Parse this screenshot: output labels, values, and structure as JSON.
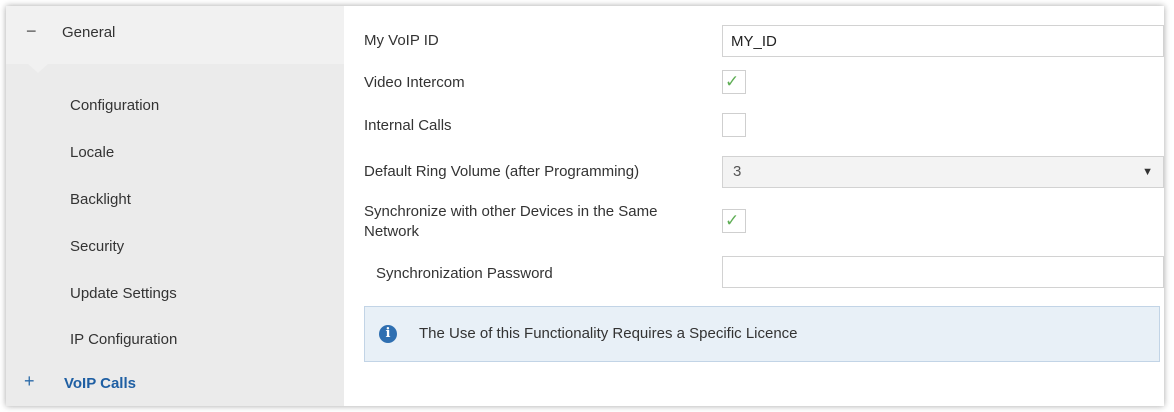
{
  "sidebar": {
    "header": {
      "sign": "−",
      "label": "General"
    },
    "items": [
      {
        "label": "Configuration"
      },
      {
        "label": "Locale"
      },
      {
        "label": "Backlight"
      },
      {
        "label": "Security"
      },
      {
        "label": "Update Settings"
      },
      {
        "label": "IP Configuration"
      }
    ],
    "group": {
      "sign": "+",
      "label": "VoIP Calls"
    }
  },
  "form": {
    "voip_id": {
      "label": "My VoIP ID",
      "value": "MY_ID"
    },
    "video_intercom": {
      "label": "Video Intercom",
      "checked": true,
      "check_glyph": "✓"
    },
    "internal_calls": {
      "label": "Internal Calls",
      "checked": false
    },
    "ring_volume": {
      "label": "Default Ring Volume (after Programming)",
      "value": "3",
      "caret": "▼"
    },
    "sync_devices": {
      "label": "Synchronize with other Devices in the Same Network",
      "checked": true,
      "check_glyph": "✓"
    },
    "sync_password": {
      "label": "Synchronization Password",
      "value": ""
    }
  },
  "info": {
    "icon_glyph": "i",
    "message": "The Use of this Functionality Requires a Specific Licence"
  },
  "colors": {
    "accent": "#1f5fa3",
    "check": "#5fae55",
    "info_bg": "#e8f0f7"
  }
}
